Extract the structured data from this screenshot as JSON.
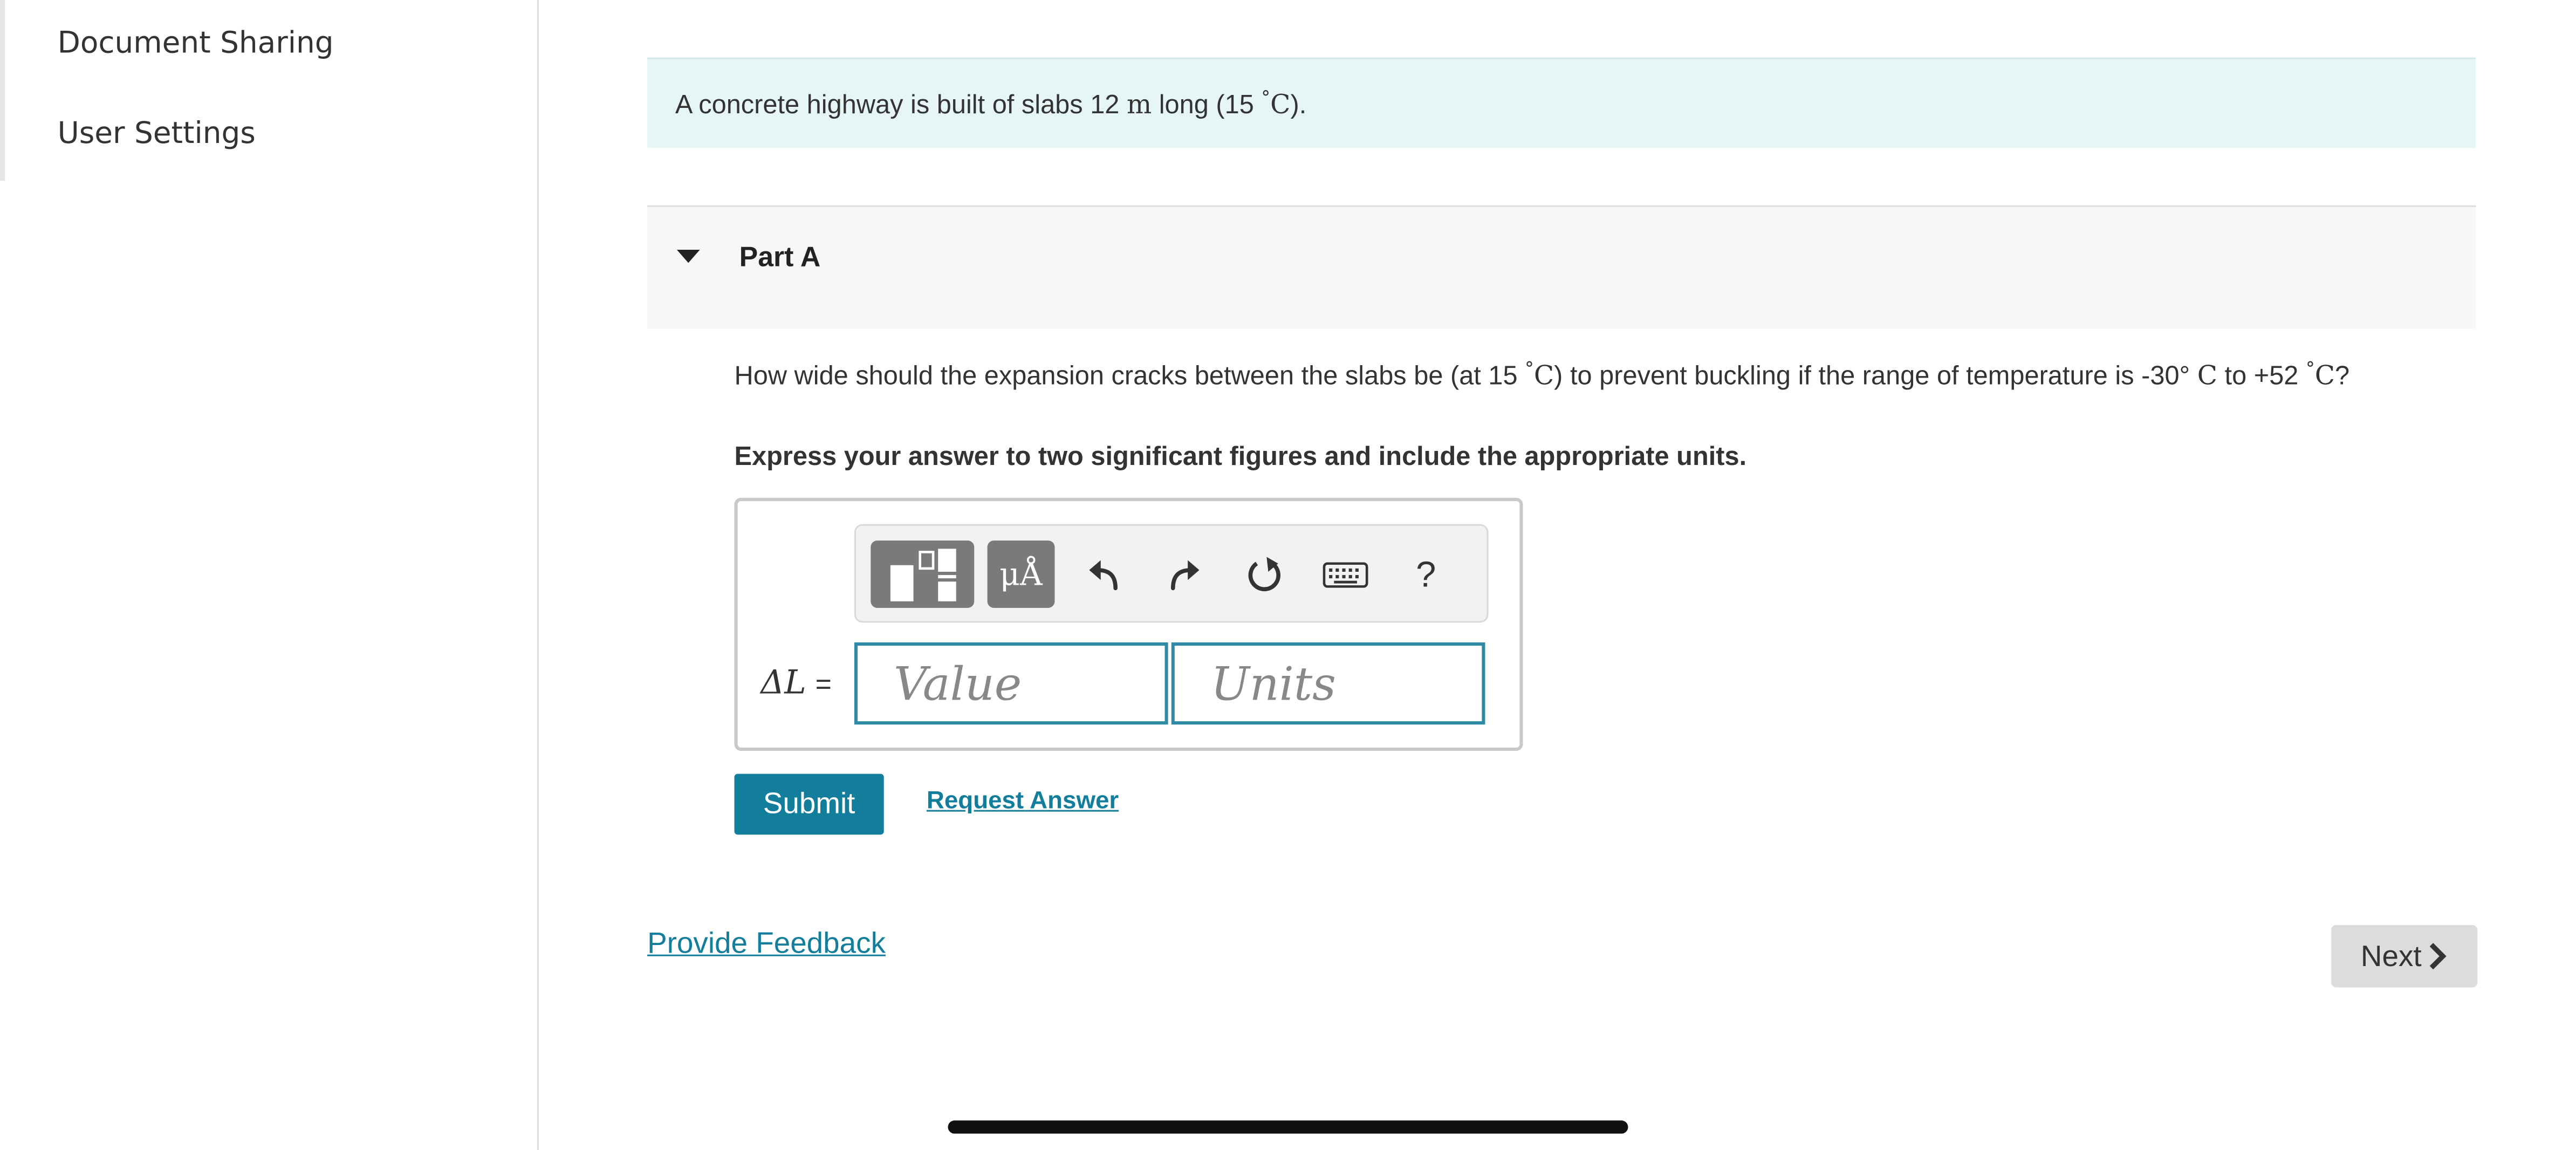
{
  "sidebar": {
    "items": [
      {
        "label": "Document Sharing"
      },
      {
        "label": "User Settings"
      }
    ]
  },
  "problem": {
    "intro_prefix": "A concrete highway is built of slabs 12 ",
    "intro_unit": "m",
    "intro_middle": " long (15 ",
    "intro_degree": "°",
    "intro_temp_unit": "C",
    "intro_suffix": ")."
  },
  "part": {
    "title": "Part A",
    "question_prefix": "How wide should the expansion cracks between the slabs be (at 15 ",
    "question_mid1": ") to prevent buckling if the range of temperature is -30",
    "question_mid2": " to +52 ",
    "question_suffix": "?",
    "degree": "°",
    "celsius": "C",
    "instruction": "Express your answer to two significant figures and include the appropriate units."
  },
  "answer": {
    "variable_label": "ΔL",
    "equals": "=",
    "value_placeholder": "Value",
    "units_placeholder": "Units",
    "value": "",
    "units": ""
  },
  "toolbar": {
    "units_button_label": "μÅ",
    "help_label": "?",
    "icons": [
      "templates-icon",
      "units-icon",
      "undo-icon",
      "redo-icon",
      "reset-icon",
      "keyboard-icon",
      "help-icon"
    ]
  },
  "actions": {
    "submit_label": "Submit",
    "request_answer_label": "Request Answer",
    "feedback_label": "Provide Feedback",
    "next_label": "Next"
  },
  "colors": {
    "accent": "#137d9c",
    "intro_bg": "#e6f6f6",
    "input_border": "#2f8aa6"
  }
}
